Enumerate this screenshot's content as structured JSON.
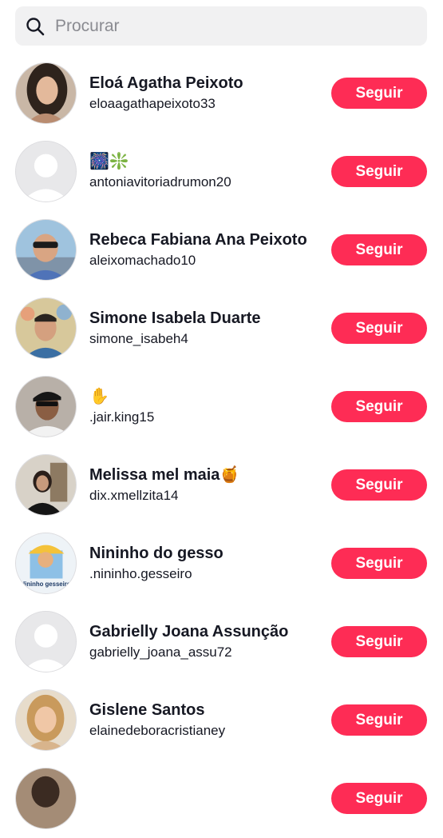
{
  "search": {
    "placeholder": "Procurar",
    "value": ""
  },
  "accent_color": "#fe2c55",
  "follow_label": "Seguir",
  "users": [
    {
      "name": "Eloá Agatha Peixoto",
      "handle": "eloaagathapeixoto33",
      "avatar": "photo-woman"
    },
    {
      "name": "🎆❇️",
      "handle": "antoniavitoriadrumon20",
      "avatar": "default"
    },
    {
      "name": "Rebeca Fabiana Ana Peixoto",
      "handle": "aleixomachado10",
      "avatar": "photo-man-sunglasses"
    },
    {
      "name": "Simone Isabela Duarte",
      "handle": "simone_isabeh4",
      "avatar": "photo-man-glasses"
    },
    {
      "name": "✋",
      "handle": ".jair.king15",
      "avatar": "photo-man-cap"
    },
    {
      "name": "Melissa mel maia🍯",
      "handle": "dix.xmellzita14",
      "avatar": "photo-woman-selfie"
    },
    {
      "name": "Nininho do gesso",
      "handle": ".nininho.gesseiro",
      "avatar": "logo-builder",
      "avatar_text": "Nininho gesseiro"
    },
    {
      "name": "Gabrielly Joana Assunção",
      "handle": "gabrielly_joana_assu72",
      "avatar": "default"
    },
    {
      "name": "Gislene Santos",
      "handle": "elainedeboracristianey",
      "avatar": "photo-woman-blonde"
    },
    {
      "name": "",
      "handle": "",
      "avatar": "photo-partial"
    }
  ]
}
